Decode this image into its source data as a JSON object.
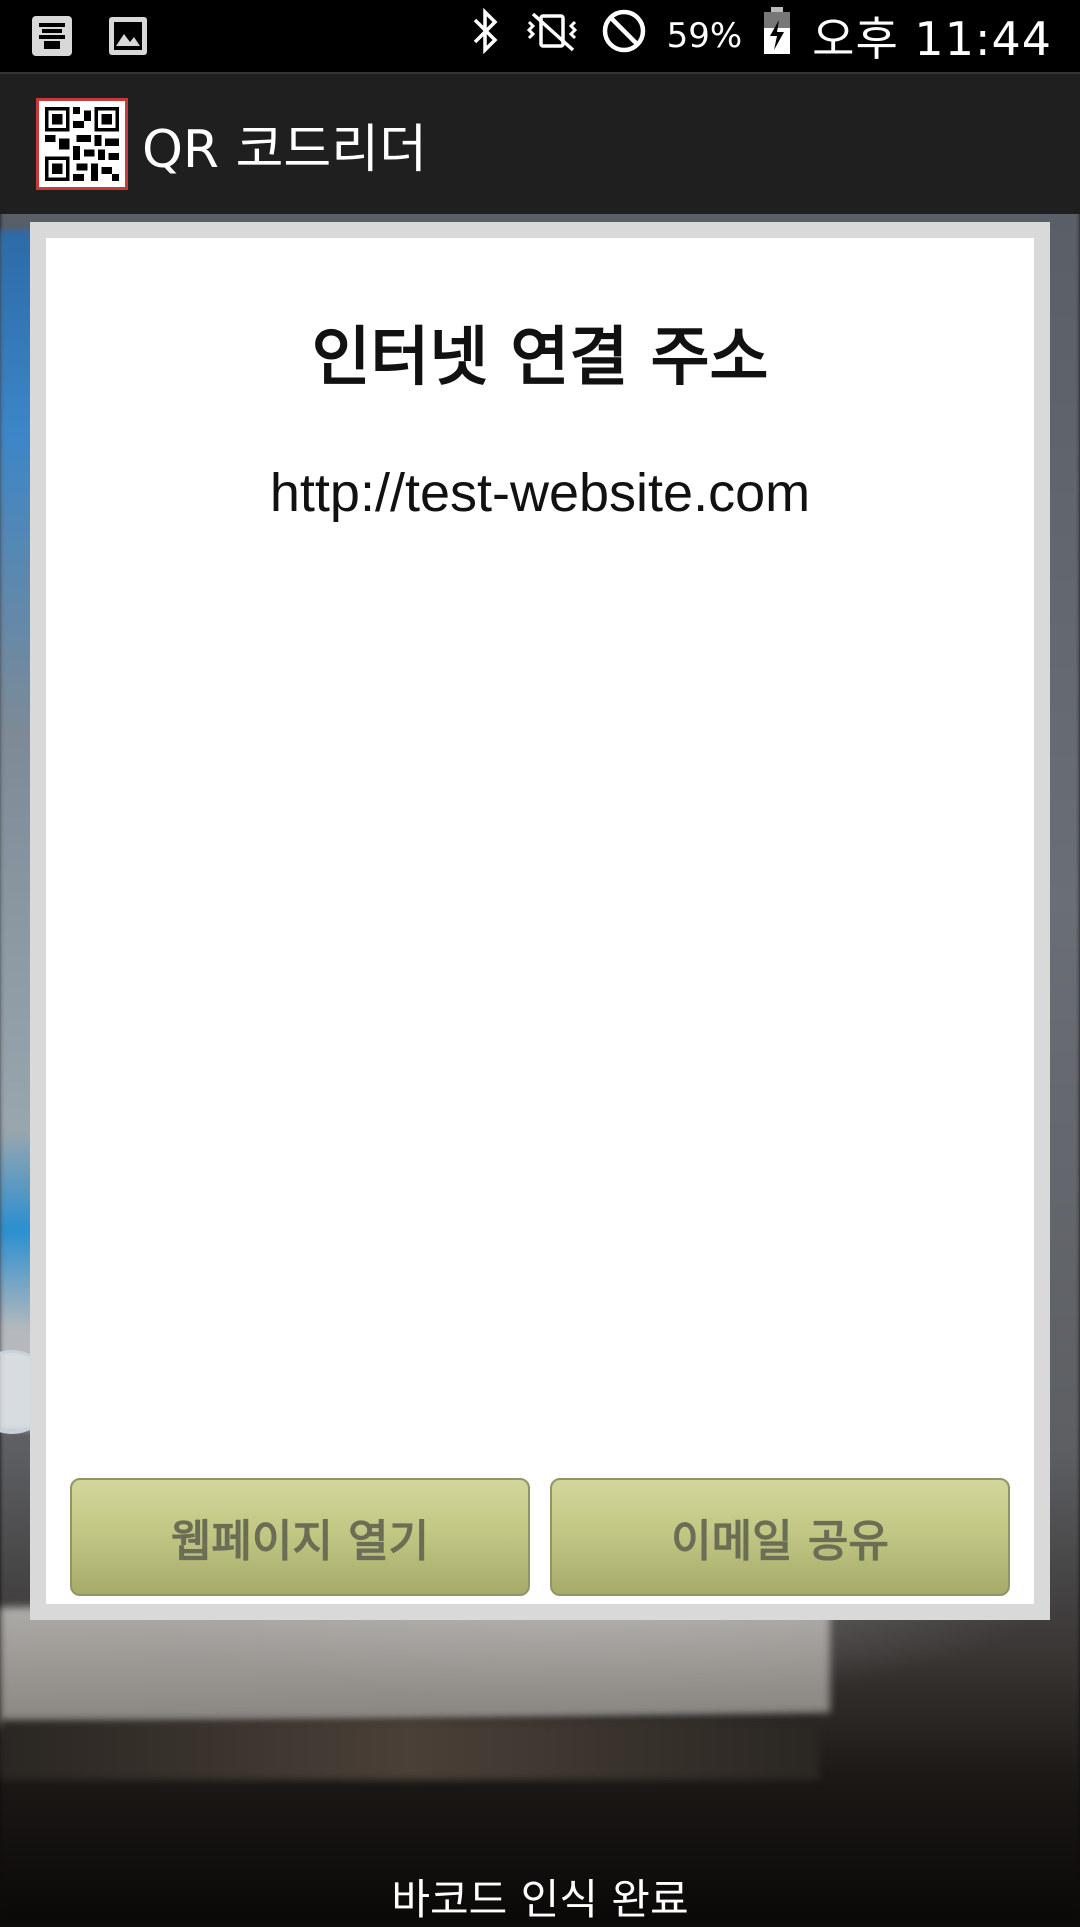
{
  "status_bar": {
    "battery_percent": "59%",
    "time": "오후 11:44",
    "icons": [
      "notification-app-icon",
      "image-icon",
      "bluetooth-icon",
      "vibrate-icon",
      "block-icon",
      "battery-charging-icon"
    ]
  },
  "app": {
    "title": "QR 코드리더",
    "icon": "qr-code-icon"
  },
  "dialog": {
    "title": "인터넷 연결 주소",
    "url": "http://test-website.com",
    "buttons": {
      "open": "웹페이지 열기",
      "share": "이메일 공유"
    }
  },
  "footer": {
    "message": "바코드 인식 완료"
  },
  "colors": {
    "button": "#c2c784",
    "button_text": "#6b6e55",
    "action_bar": "#1f1f1f",
    "icon_border": "#c83a3a"
  }
}
